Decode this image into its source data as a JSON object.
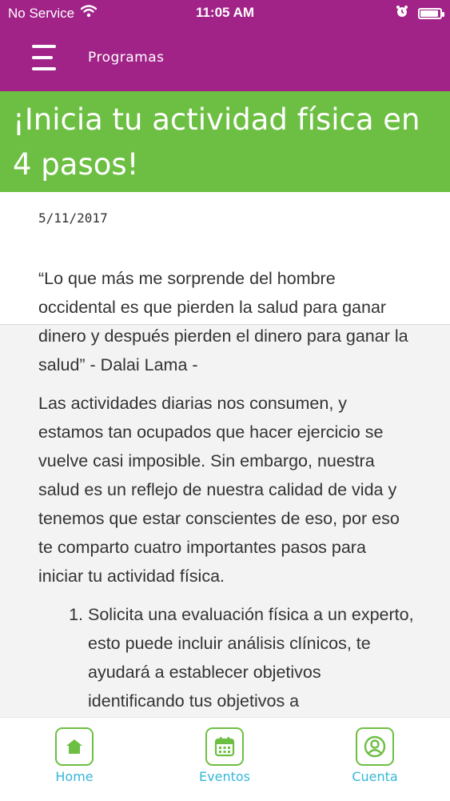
{
  "status_bar": {
    "carrier": "No Service",
    "time": "11:05 AM",
    "battery_level": 0.9
  },
  "header": {
    "title": "Programas",
    "menu_icon": "hamburger-icon"
  },
  "article": {
    "title": "¡Inicia tu actividad física en 4 pasos!",
    "date": "5/11/2017",
    "paragraphs": [
      "“Lo que más me sorprende del hombre occidental es que pierden la salud para ganar dinero y después pierden el dinero para ganar la salud” - Dalai Lama -",
      "Las actividades diarias nos consumen, y estamos tan ocupados que hacer ejercicio se vuelve casi imposible. Sin embargo, nuestra salud es un reflejo de nuestra calidad de vida y tenemos que estar conscientes de eso, por eso te comparto cuatro importantes pasos para iniciar tu actividad física."
    ],
    "steps": [
      "Solicita una evaluación física a un experto, esto puede incluir análisis clínicos, te ayudará a establecer objetivos identificando tus objetivos a"
    ]
  },
  "tabs": [
    {
      "label": "Home",
      "icon": "home-icon"
    },
    {
      "label": "Eventos",
      "icon": "calendar-icon"
    },
    {
      "label": "Cuenta",
      "icon": "account-icon"
    }
  ],
  "colors": {
    "header": "#a12388",
    "accent_green": "#6dbf43",
    "tab_text": "#34b7d8"
  }
}
